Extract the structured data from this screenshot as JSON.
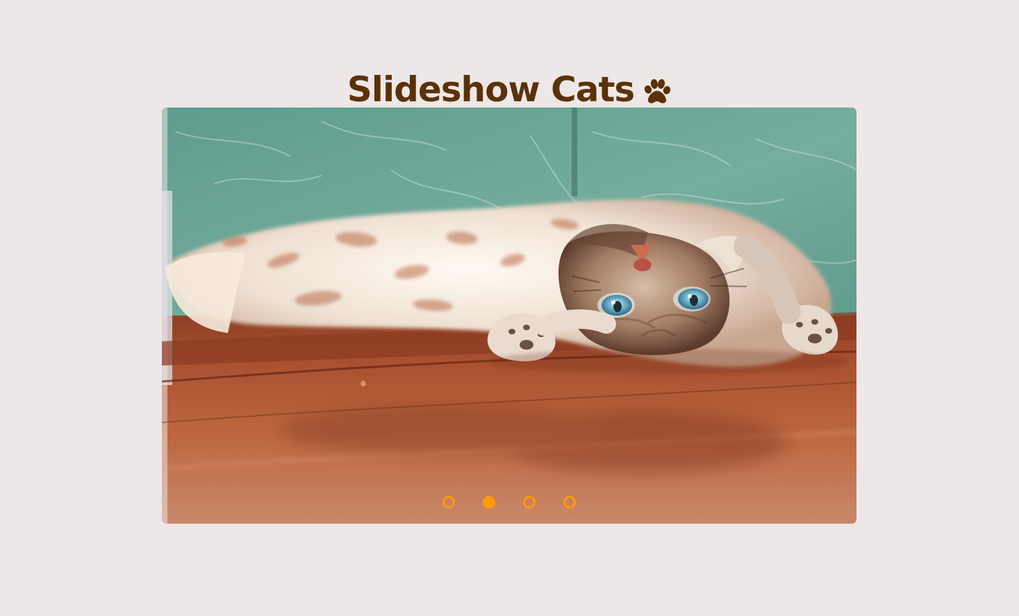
{
  "header": {
    "title": "Slideshow Cats",
    "icon": "paw-icon",
    "color": "#5a3208"
  },
  "slideshow": {
    "current_slide": 2,
    "slide_count": 4,
    "image": {
      "subject": "cat",
      "icon": "cat-photo"
    },
    "dots": [
      {
        "label": "",
        "active": false
      },
      {
        "label": "",
        "active": true
      },
      {
        "label": "",
        "active": false
      },
      {
        "label": "",
        "active": false
      }
    ],
    "accent_color": "#ff9b00"
  }
}
